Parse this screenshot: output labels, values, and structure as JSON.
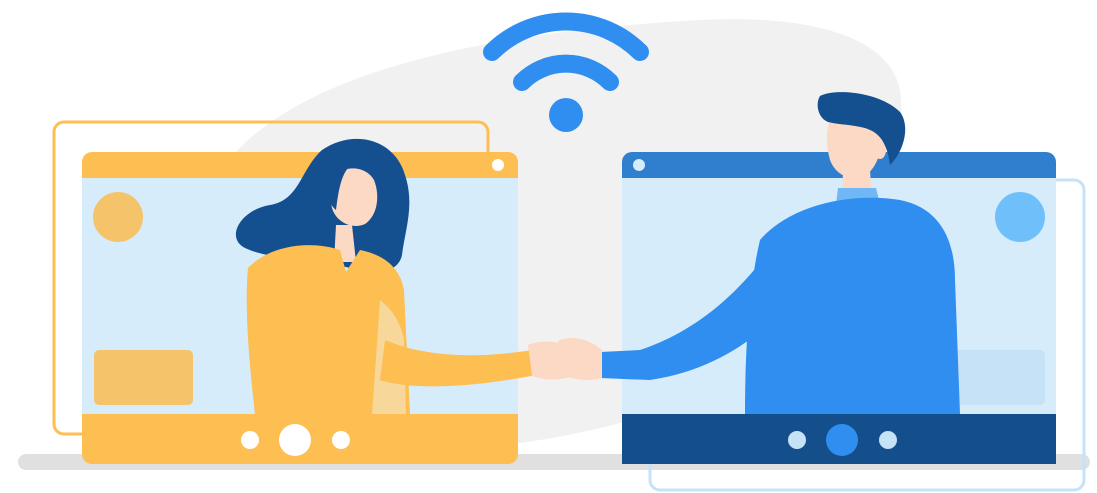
{
  "scene": {
    "description_label": "",
    "left_window": {
      "role": "video-call-window",
      "accent_color": "#FDBE52",
      "screen_color": "#D6ECFA",
      "controls": [
        "dot",
        "dot-large",
        "dot"
      ]
    },
    "right_window": {
      "role": "video-call-window",
      "accent_color": "#2F7FCE",
      "bar_color": "#144F8C",
      "screen_color": "#D6ECFA",
      "controls": [
        "dot",
        "dot-large",
        "dot"
      ]
    },
    "icons": [
      "wifi-icon",
      "handshake"
    ],
    "colors": {
      "orange": "#FDBE52",
      "blue": "#2F8EF0",
      "navy": "#144F8C",
      "light_blue": "#D6ECFA",
      "gray_blob": "#F1F1F1",
      "skin": "#FBD9C4",
      "hair_dark": "#14508F"
    }
  }
}
